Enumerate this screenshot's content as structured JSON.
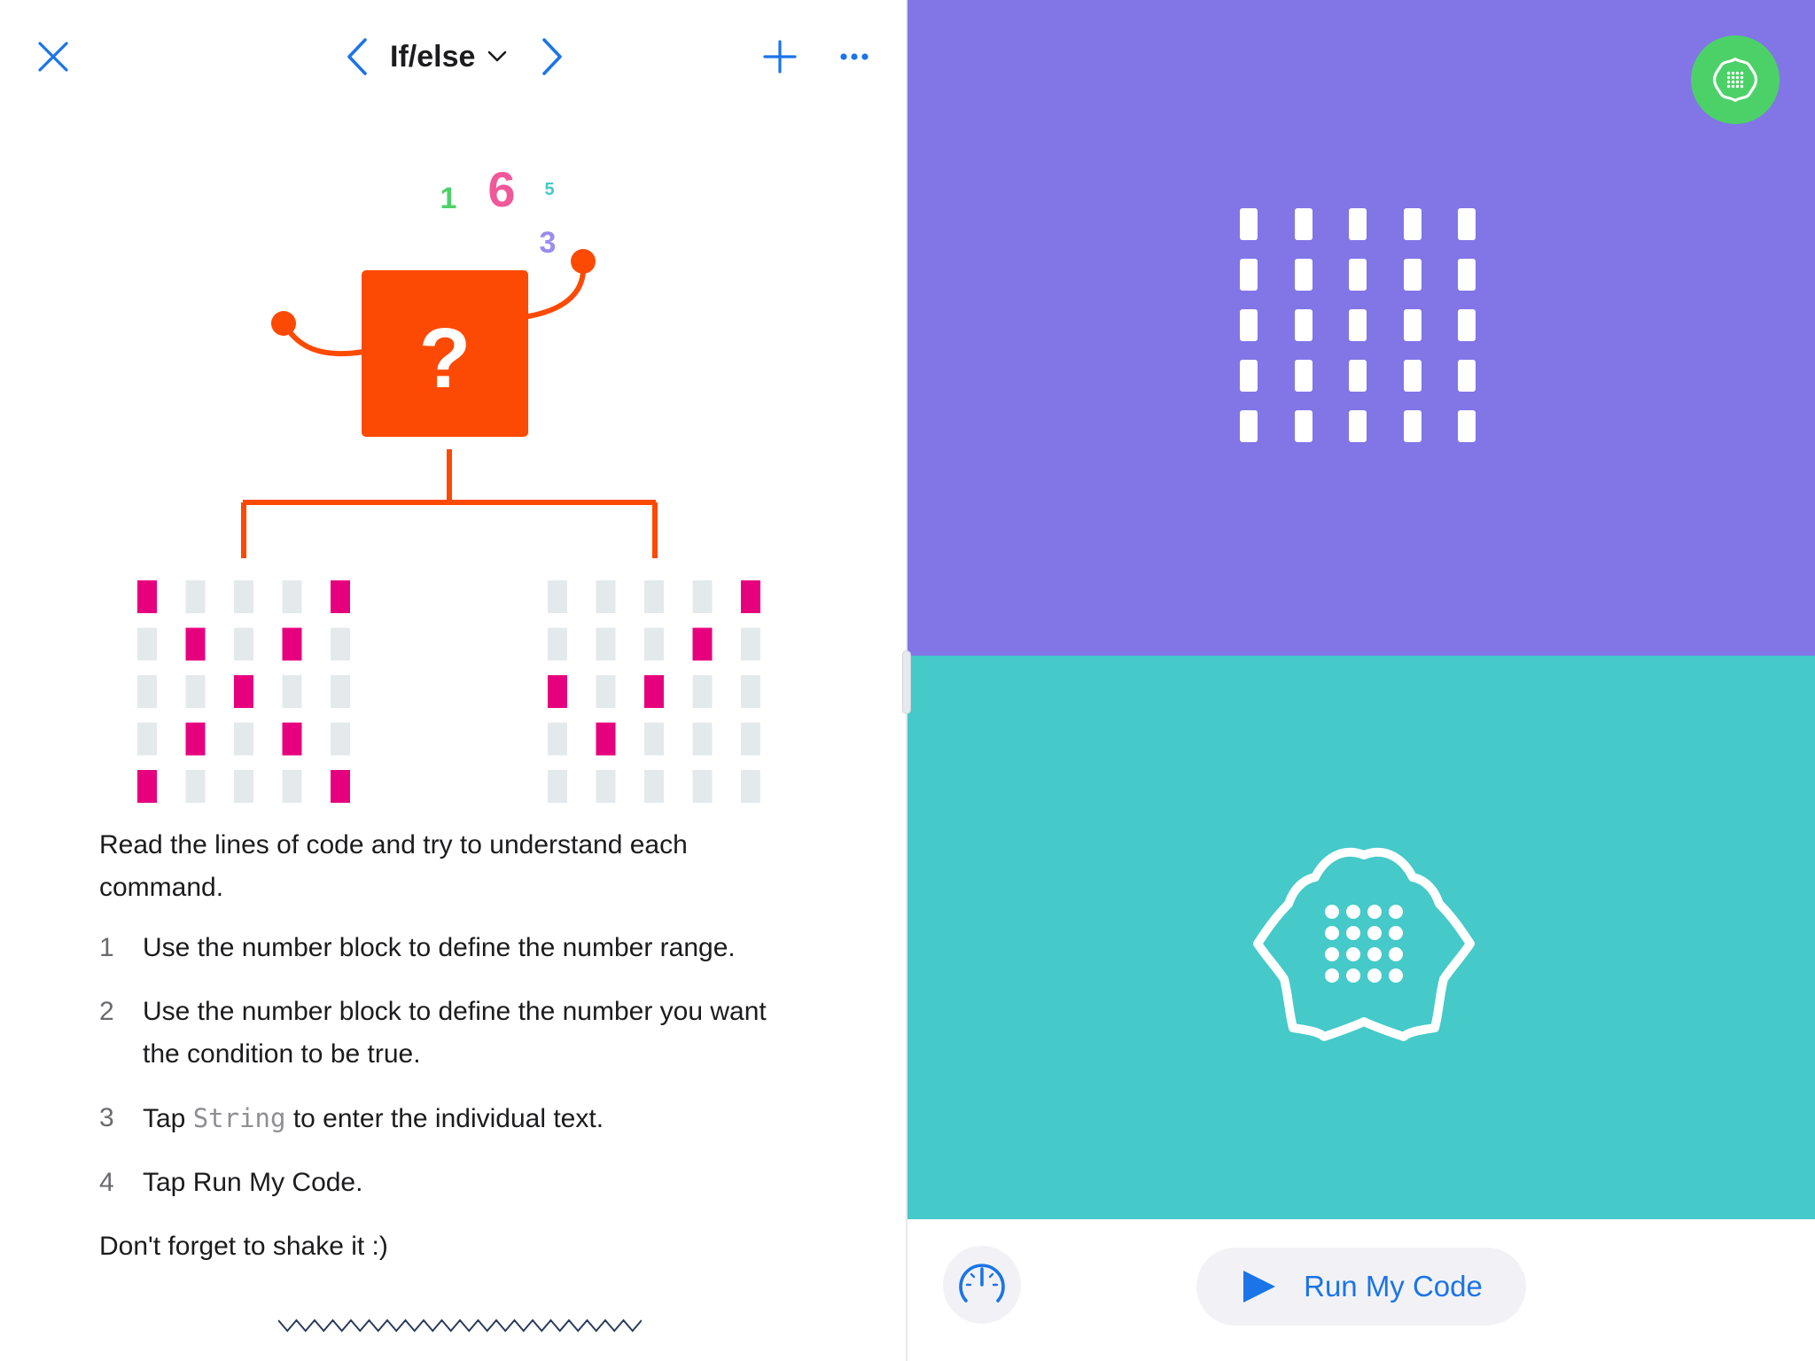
{
  "header": {
    "title": "If/else",
    "close_icon": "close-icon",
    "prev_icon": "chevron-left-icon",
    "next_icon": "chevron-right-icon",
    "dropdown_icon": "chevron-down-icon",
    "add_icon": "plus-icon",
    "more_icon": "ellipsis-icon"
  },
  "illustration": {
    "numbers": [
      "1",
      "6",
      "5",
      "3"
    ],
    "box_symbol": "?",
    "left_pattern": [
      [
        1,
        0,
        0,
        0,
        1
      ],
      [
        0,
        1,
        0,
        1,
        0
      ],
      [
        0,
        0,
        1,
        0,
        0
      ],
      [
        0,
        1,
        0,
        1,
        0
      ],
      [
        1,
        0,
        0,
        0,
        1
      ]
    ],
    "right_pattern": [
      [
        0,
        0,
        0,
        0,
        1
      ],
      [
        0,
        0,
        0,
        1,
        0
      ],
      [
        1,
        0,
        1,
        0,
        0
      ],
      [
        0,
        1,
        0,
        0,
        0
      ],
      [
        0,
        0,
        0,
        0,
        0
      ]
    ]
  },
  "instructions": {
    "intro": "Read the lines of code and try to understand each command.",
    "steps": [
      {
        "num": "1",
        "text": "Use the number block to define the number range."
      },
      {
        "num": "2",
        "text": "Use the number block to define the number you want the condition to be true."
      },
      {
        "num": "3",
        "pre": "Tap ",
        "code": "String",
        "post": " to enter the individual text."
      },
      {
        "num": "4",
        "text": "Tap Run My Code."
      }
    ],
    "closing": "Don't forget to shake it :)"
  },
  "live_view": {
    "led_grid": [
      [
        1,
        1,
        1,
        1,
        1
      ],
      [
        1,
        1,
        1,
        1,
        1
      ],
      [
        1,
        1,
        1,
        1,
        1
      ],
      [
        1,
        1,
        1,
        1,
        1
      ],
      [
        1,
        1,
        1,
        1,
        1
      ]
    ],
    "microbit_icon": "microbit-icon"
  },
  "toolbar": {
    "speed_icon": "speedometer-icon",
    "run_icon": "play-icon",
    "run_label": "Run My Code"
  },
  "colors": {
    "accent": "#1b74e8",
    "stage_top": "#8275e6",
    "stage_bottom": "#45c9c9",
    "illustration_orange": "#fc4a04",
    "led_on": "#e6007e",
    "led_off": "#e4e9ec",
    "button_green": "#4cd168"
  }
}
